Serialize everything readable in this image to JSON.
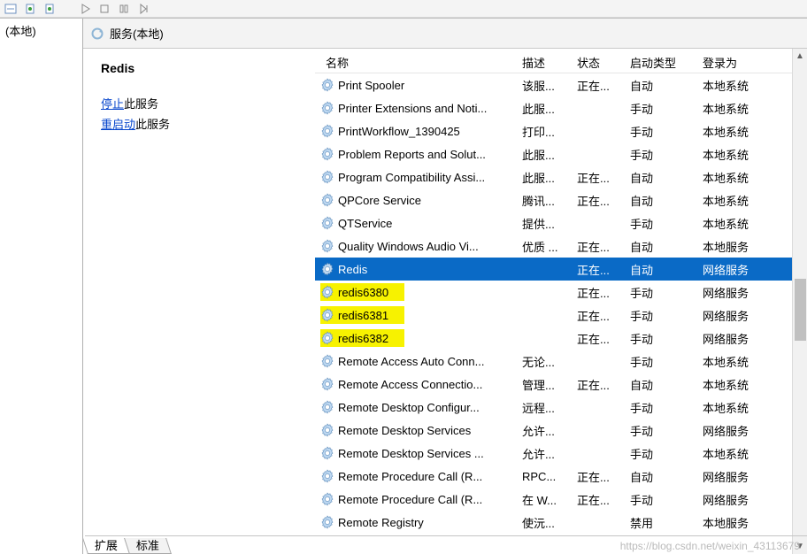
{
  "left": {
    "root": "(本地)"
  },
  "header": {
    "title": "服务(本地)"
  },
  "selected_service": "Redis",
  "actions": {
    "stop_link": "停止",
    "stop_suffix": "此服务",
    "restart_link": "重启动",
    "restart_suffix": "此服务"
  },
  "columns": {
    "name": "名称",
    "description": "描述",
    "status": "状态",
    "startup": "启动类型",
    "logon": "登录为"
  },
  "services": [
    {
      "name": "Print Spooler",
      "desc": "该服...",
      "state": "正在...",
      "start": "自动",
      "logon": "本地系统"
    },
    {
      "name": "Printer Extensions and Noti...",
      "desc": "此服...",
      "state": "",
      "start": "手动",
      "logon": "本地系统"
    },
    {
      "name": "PrintWorkflow_1390425",
      "desc": "打印...",
      "state": "",
      "start": "手动",
      "logon": "本地系统"
    },
    {
      "name": "Problem Reports and Solut...",
      "desc": "此服...",
      "state": "",
      "start": "手动",
      "logon": "本地系统"
    },
    {
      "name": "Program Compatibility Assi...",
      "desc": "此服...",
      "state": "正在...",
      "start": "自动",
      "logon": "本地系统"
    },
    {
      "name": "QPCore Service",
      "desc": "腾讯...",
      "state": "正在...",
      "start": "自动",
      "logon": "本地系统"
    },
    {
      "name": "QTService",
      "desc": "提供...",
      "state": "",
      "start": "手动",
      "logon": "本地系统"
    },
    {
      "name": "Quality Windows Audio Vi...",
      "desc": "优质 ...",
      "state": "正在...",
      "start": "自动",
      "logon": "本地服务"
    },
    {
      "name": "Redis",
      "desc": "",
      "state": "正在...",
      "start": "自动",
      "logon": "网络服务",
      "selected": true
    },
    {
      "name": "redis6380",
      "desc": "",
      "state": "正在...",
      "start": "手动",
      "logon": "网络服务",
      "highlight": true
    },
    {
      "name": "redis6381",
      "desc": "",
      "state": "正在...",
      "start": "手动",
      "logon": "网络服务",
      "highlight": true
    },
    {
      "name": "redis6382",
      "desc": "",
      "state": "正在...",
      "start": "手动",
      "logon": "网络服务",
      "highlight": true
    },
    {
      "name": "Remote Access Auto Conn...",
      "desc": "无论...",
      "state": "",
      "start": "手动",
      "logon": "本地系统"
    },
    {
      "name": "Remote Access Connectio...",
      "desc": "管理...",
      "state": "正在...",
      "start": "自动",
      "logon": "本地系统"
    },
    {
      "name": "Remote Desktop Configur...",
      "desc": "远程...",
      "state": "",
      "start": "手动",
      "logon": "本地系统"
    },
    {
      "name": "Remote Desktop Services",
      "desc": "允许...",
      "state": "",
      "start": "手动",
      "logon": "网络服务"
    },
    {
      "name": "Remote Desktop Services ...",
      "desc": "允许...",
      "state": "",
      "start": "手动",
      "logon": "本地系统"
    },
    {
      "name": "Remote Procedure Call (R...",
      "desc": "RPC...",
      "state": "正在...",
      "start": "自动",
      "logon": "网络服务"
    },
    {
      "name": "Remote Procedure Call (R...",
      "desc": "在 W...",
      "state": "正在...",
      "start": "手动",
      "logon": "网络服务"
    },
    {
      "name": "Remote Registry",
      "desc": "使沅...",
      "state": "",
      "start": "禁用",
      "logon": "本地服务"
    }
  ],
  "tabs": {
    "extended": "扩展",
    "standard": "标准"
  },
  "watermark": "https://blog.csdn.net/weixin_43113679"
}
